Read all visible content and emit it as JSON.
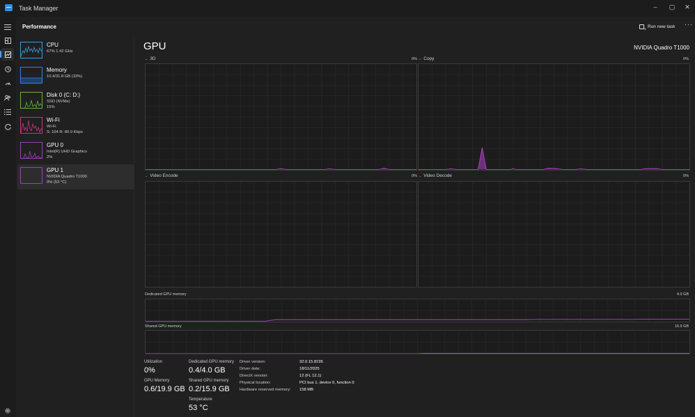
{
  "window": {
    "title": "Task Manager",
    "minimize": "–",
    "maximize": "▢",
    "close": "✕"
  },
  "header": {
    "page_title": "Performance",
    "run_new_task": "Run new task",
    "more": "···"
  },
  "devices": [
    {
      "name": "CPU",
      "line1": "67% 1.42 GHz",
      "line2": "",
      "color": "#3aa0e0"
    },
    {
      "name": "Memory",
      "line1": "10.4/31.8 GB (33%)",
      "line2": "",
      "color": "#3a7fe0"
    },
    {
      "name": "Disk 0 (C: D:)",
      "line1": "SSD (NVMe)",
      "line2": "15%",
      "color": "#6cb33a"
    },
    {
      "name": "Wi-Fi",
      "line1": "Wi-Fi",
      "line2": "S: 104  R: 80.0 Kbps",
      "color": "#c0397a"
    },
    {
      "name": "GPU 0",
      "line1": "Intel(R) UHD Graphics",
      "line2": "2%",
      "color": "#9b3fb8"
    },
    {
      "name": "GPU 1",
      "line1": "NVIDIA Quadro T1000",
      "line2": "0% (53 °C)",
      "color": "#9b3fb8"
    }
  ],
  "gpu": {
    "title": "GPU",
    "model": "NVIDIA Quadro T1000",
    "engines": [
      {
        "label": "3D",
        "pct": "0%"
      },
      {
        "label": "Copy",
        "pct": "0%"
      },
      {
        "label": "Video Encode",
        "pct": "0%"
      },
      {
        "label": "Video Decode",
        "pct": "0%"
      }
    ],
    "dedicated_label": "Dedicated GPU memory",
    "dedicated_max": "4.0 GB",
    "shared_label": "Shared GPU memory",
    "shared_max": "15.9 GB",
    "line_color": "#b042c8"
  },
  "stats": {
    "utilization_label": "Utilization",
    "utilization": "0%",
    "gpu_memory_label": "GPU Memory",
    "gpu_memory": "0.6/19.9 GB",
    "dedicated_label": "Dedicated GPU memory",
    "dedicated": "0.4/4.0 GB",
    "shared_label": "Shared GPU memory",
    "shared": "0.2/15.9 GB",
    "temperature_label": "Temperature",
    "temperature": "53 °C"
  },
  "info": [
    {
      "key": "Driver version:",
      "value": "32.0.15.8195"
    },
    {
      "key": "Driver date:",
      "value": "18/11/2025"
    },
    {
      "key": "DirectX version:",
      "value": "12 (FL 12.1)"
    },
    {
      "key": "Physical location:",
      "value": "PCI bus 1, device 0, function 0"
    },
    {
      "key": "Hardware reserved memory:",
      "value": "158 MB"
    }
  ]
}
